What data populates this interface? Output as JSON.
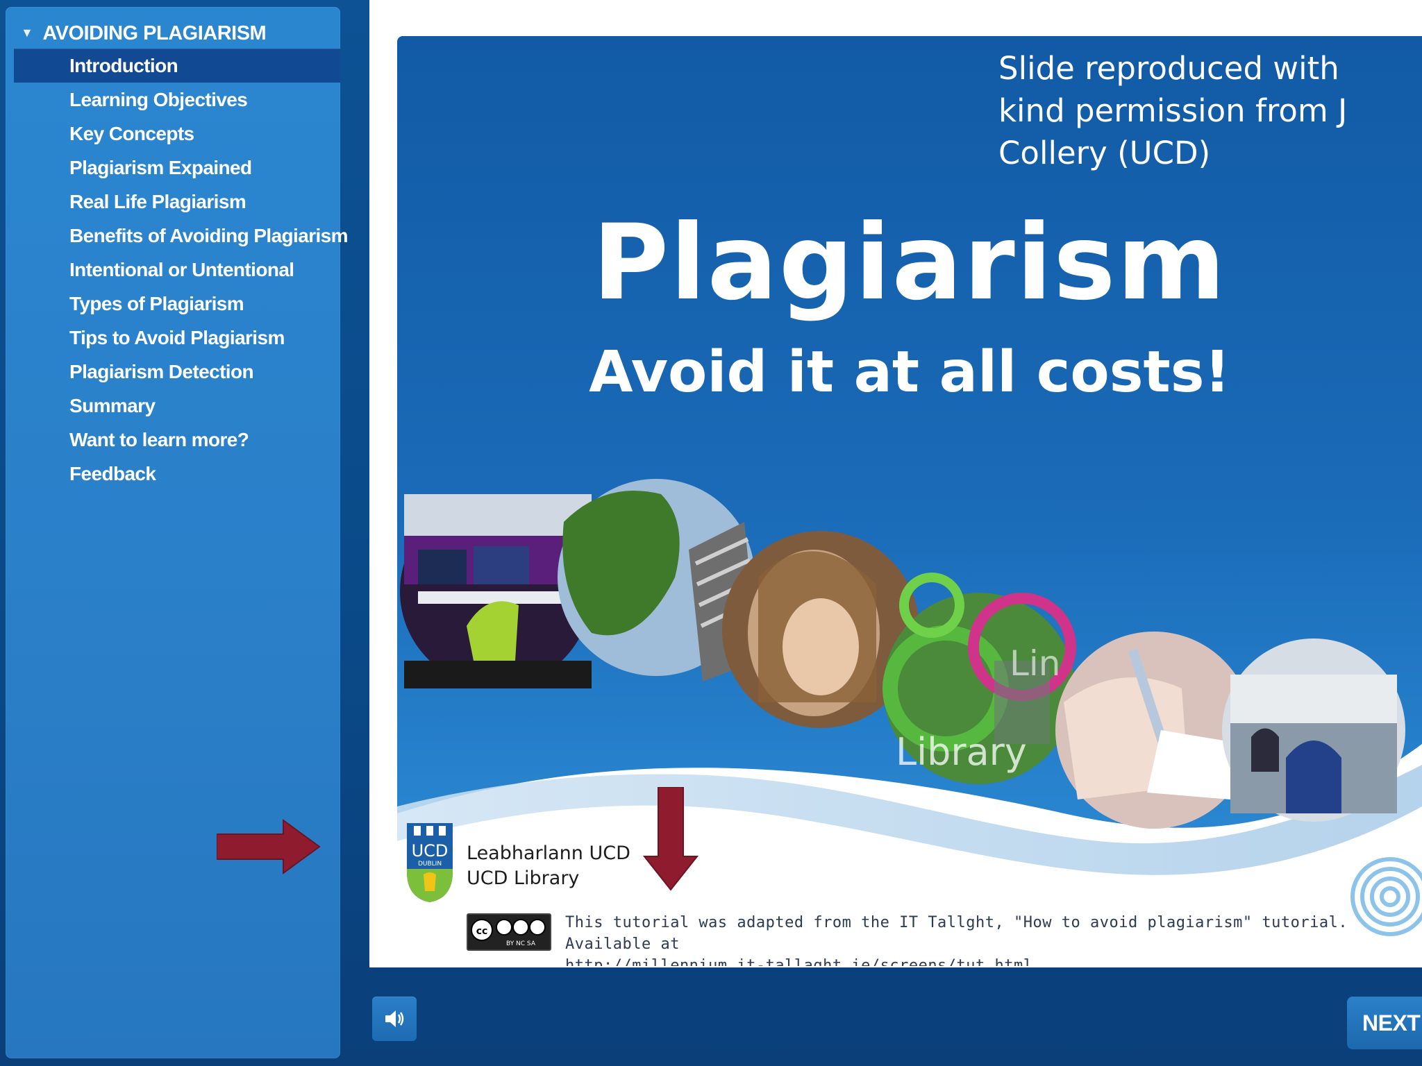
{
  "sidebar": {
    "header": "AVOIDING PLAGIARISM",
    "items": [
      {
        "label": "Introduction",
        "active": true
      },
      {
        "label": "Learning Objectives"
      },
      {
        "label": "Key Concepts"
      },
      {
        "label": "Plagiarism Expained"
      },
      {
        "label": "Real Life Plagiarism"
      },
      {
        "label": "Benefits of Avoiding Plagiarism"
      },
      {
        "label": "Intentional or Untentional"
      },
      {
        "label": "Types of Plagiarism"
      },
      {
        "label": "Tips to Avoid Plagiarism"
      },
      {
        "label": "Plagiarism Detection"
      },
      {
        "label": "Summary"
      },
      {
        "label": "Want to learn more?"
      },
      {
        "label": "Feedback"
      }
    ]
  },
  "slide": {
    "credit": "Slide reproduced with kind permission from J Collery (UCD)",
    "title": "Plagiarism",
    "subtitle": "Avoid it at all costs!",
    "photo_labels": {
      "library": "Library",
      "link": "Lin"
    },
    "library_name_irish": "Leabharlann UCD",
    "library_name": "UCD Library",
    "crest_text": "UCD",
    "crest_subtext": "DUBLIN",
    "cc_text": "cc",
    "cc_terms": "BY  NC  SA",
    "attribution_line1": "This tutorial was adapted from the IT Tallght, \"How to avoid plagiarism\" tutorial. Available at",
    "attribution_line2": "http://millennium.it-tallaght.ie/screens/tut.html"
  },
  "controls": {
    "audio_icon": "speaker-icon",
    "next_label": "NEXT"
  },
  "colors": {
    "app_bg": "#0c5294",
    "sidebar": "#2a7fc8",
    "active_item": "#114a92",
    "slide_blue": "#1966b3",
    "annotation_arrow": "#8e1c2e"
  }
}
